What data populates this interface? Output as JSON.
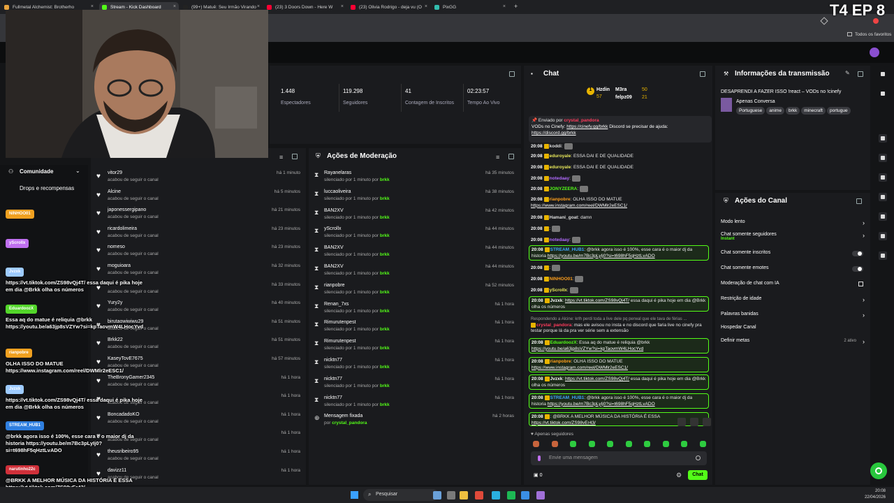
{
  "overlay_title": "T4 EP 8",
  "browser": {
    "tabs": [
      {
        "label": "Fullmetal Alchemist: Brotherho",
        "color": "#e8a33d"
      },
      {
        "label": "Stream - Kick Dashboard",
        "color": "#53fc18"
      },
      {
        "label": "(99+) Matuê: Seu Irmão Virando",
        "color": "#222222"
      },
      {
        "label": "(23) 3 Doors Down - Here W",
        "color": "#ff0033"
      },
      {
        "label": "(23) Olivia Rodrigo - deja vu (O",
        "color": "#ff0033"
      },
      {
        "label": "PixGG",
        "color": "#32bcad"
      }
    ],
    "new_tab": "+",
    "bookmarks_all": "Todos os favoritos"
  },
  "stats": [
    {
      "value": "1.448",
      "label": "Espectadores"
    },
    {
      "value": "119.298",
      "label": "Seguidores"
    },
    {
      "value": "41",
      "label": "Contagem de Inscritos"
    },
    {
      "value": "02:23:57",
      "label": "Tempo Ao Vivo"
    }
  ],
  "followers_panel": {
    "rows": [
      {
        "name": "vitor29",
        "sub": "acabou de seguir o canal",
        "time": "há 1 minuto"
      },
      {
        "name": "Alcine",
        "sub": "acabou de seguir o canal",
        "time": "há 5 minutos"
      },
      {
        "name": "japonessergipano",
        "sub": "acabou de seguir o canal",
        "time": "há 21 minutos"
      },
      {
        "name": "ricardolimeira",
        "sub": "acabou de seguir o canal",
        "time": "há 23 minutos"
      },
      {
        "name": "nomeso",
        "sub": "acabou de seguir o canal",
        "time": "há 23 minutos"
      },
      {
        "name": "moguioara",
        "sub": "acabou de seguir o canal",
        "time": "há 32 minutos"
      },
      {
        "name": "",
        "sub": "acabou de seguir o canal",
        "time": "há 33 minutos"
      },
      {
        "name": "Yury2y",
        "sub": "acabou de seguir o canal",
        "time": "há 40 minutos"
      },
      {
        "name": "birutaowiwiwu29",
        "sub": "acabou de seguir o canal",
        "time": "há 51 minutos"
      },
      {
        "name": "Brkk22",
        "sub": "acabou de seguir o canal",
        "time": "há 51 minutos"
      },
      {
        "name": "KaseyTovE7675",
        "sub": "acabou de seguir o canal",
        "time": "há 57 minutos"
      },
      {
        "name": "TheBronyGamer2345",
        "sub": "acabou de seguir o canal",
        "time": "há 1 hora"
      },
      {
        "name": "",
        "sub": "acabou de seguir o canal",
        "time": "há 1 hora"
      },
      {
        "name": "BoncadadoKO",
        "sub": "acabou de seguir o canal",
        "time": "há 1 hora"
      },
      {
        "name": "",
        "sub": "acabou de seguir o canal",
        "time": "há 1 hora"
      },
      {
        "name": "theusribeiro95",
        "sub": "acabou de seguir o canal",
        "time": "há 1 hora"
      },
      {
        "name": "davizz11",
        "sub": "acabou de seguir o canal",
        "time": "há 1 hora"
      }
    ]
  },
  "moderation_panel": {
    "title": "Ações de Moderação",
    "rows": [
      {
        "name": "Rayanelaras",
        "sub": "silenciado por 1 minuto por",
        "by": "brkk",
        "time": "há 35 minutos"
      },
      {
        "name": "luccaoliveira",
        "sub": "silenciado por 1 minuto por",
        "by": "brkk",
        "time": "há 38 minutos"
      },
      {
        "name": "BAN2XV",
        "sub": "silenciado por 1 minuto por",
        "by": "brkk",
        "time": "há 42 minutos"
      },
      {
        "name": "yScrollx",
        "sub": "silenciado por 1 minuto por",
        "by": "brkk",
        "time": "há 44 minutos"
      },
      {
        "name": "BAN2XV",
        "sub": "silenciado por 1 minuto por",
        "by": "brkk",
        "time": "há 44 minutos"
      },
      {
        "name": "BAN2XV",
        "sub": "silenciado por 1 minuto por",
        "by": "brkk",
        "time": "há 44 minutos"
      },
      {
        "name": "rianpobre",
        "sub": "silenciado por 1 minuto por",
        "by": "brkk",
        "time": "há 52 minutos"
      },
      {
        "name": "Renan_7xs",
        "sub": "silenciado por 1 minuto por",
        "by": "brkk",
        "time": "há 1 hora"
      },
      {
        "name": "Rimurutenpest",
        "sub": "silenciado por 1 minuto por",
        "by": "brkk",
        "time": "há 1 hora"
      },
      {
        "name": "Rimurutenpest",
        "sub": "silenciado por 1 minuto por",
        "by": "brkk",
        "time": "há 1 hora"
      },
      {
        "name": "nicktn77",
        "sub": "silenciado por 1 minuto por",
        "by": "brkk",
        "time": "há 1 hora"
      },
      {
        "name": "nicktn77",
        "sub": "silenciado por 1 minuto por",
        "by": "brkk",
        "time": "há 1 hora"
      },
      {
        "name": "nicktn77",
        "sub": "silenciado por 1 minuto por",
        "by": "brkk",
        "time": "há 1 hora"
      },
      {
        "name": "Mensagem fixada",
        "sub": "por",
        "by": "crystal_pandora",
        "time": "há 2 horas"
      }
    ]
  },
  "chat": {
    "title": "Chat",
    "leaderboard": [
      {
        "rank": "1",
        "name": "Hzdin",
        "pts": "57"
      },
      {
        "rank": "",
        "name": "M3ra",
        "pts": "50"
      },
      {
        "rank": "",
        "name": "felpz09",
        "pts": "21"
      }
    ],
    "pinned": {
      "label": "Enviado por",
      "user": "crystal_pandora",
      "text": "VODs no Cinefy:",
      "link1": "https://cinefy.gg/brkk",
      "text2": "Discord se precisar de ajuda:",
      "link2": "https://discord.gg/brkk"
    },
    "messages": [
      {
        "t": "20:08",
        "u": "koddi",
        "c": "#dddddd",
        "m": "",
        "hl": false
      },
      {
        "t": "20:08",
        "u": "eduroyale",
        "c": "#e8e85a",
        "m": "ESSA DAI E DE QUALIDADE",
        "hl": false
      },
      {
        "t": "20:08",
        "u": "eduroyale",
        "c": "#e8e85a",
        "m": "ESSA DAI E DE QUALIDADE",
        "hl": false
      },
      {
        "t": "20:08",
        "u": "notedaay",
        "c": "#b26bff",
        "m": "",
        "hl": false
      },
      {
        "t": "20:08",
        "u": "JONYZEERA",
        "c": "#53fc18",
        "m": "",
        "hl": false
      },
      {
        "t": "20:08",
        "u": "rianpobre",
        "c": "#ff9f1c",
        "m": "OLHA ISSO DO MATUE",
        "link": "https://www.instagram.com/reel/DWMlr2eESC1/",
        "hl": false
      },
      {
        "t": "20:08",
        "u": "Hamani_goat",
        "c": "#dddddd",
        "m": "damn",
        "hl": false
      },
      {
        "t": "20:08",
        "u": "",
        "c": "#ff3b5c",
        "m": "",
        "hl": false
      },
      {
        "t": "20:08",
        "u": "notedaay",
        "c": "#b26bff",
        "m": "",
        "hl": false
      },
      {
        "t": "20:08",
        "u": "STREAM_HUB1",
        "c": "#3ea6ff",
        "m": "@brkk agora isso é 100%, esse cara é o maior dj da historia",
        "link": "https://youtu.be/m7Bc3pLyIj0?si=t698hF5qHztLvADO",
        "hl": true
      },
      {
        "t": "20:08",
        "u": "",
        "c": "#ff3b5c",
        "m": "",
        "hl": false
      },
      {
        "t": "20:08",
        "u": "NINHOO01",
        "c": "#ff9f1c",
        "m": "",
        "hl": false
      },
      {
        "t": "20:08",
        "u": "yScrollx",
        "c": "#e8e85a",
        "m": "",
        "hl": false
      },
      {
        "t": "20:08",
        "u": "Jvzxk",
        "c": "#ffffff",
        "m": "",
        "link": "https://vt.tiktok.com/ZS98vQj4T/",
        "m2": "essa daqui é pika hoje em dia @Brkk olha os números",
        "hl": true
      },
      {
        "t": "",
        "u": "crystal_pandora",
        "c": "#ff3b5c",
        "reply": "Respondendo a Alcine: krlh perdi toda a live dele pq perwal que ele tava de férias ...",
        "m": "mas ele avisou no insta e no discord que faria live no cinefy pra testar porque lá da pra ver série sem a extensão",
        "hl": false
      },
      {
        "t": "20:08",
        "u": "EduardoozX",
        "c": "#53fc18",
        "m": "Essa aq do matue é reliquia @brkk",
        "link": "https://youtu.be/a63jp8sVZYw?si=kpTaovmW4LHocYvd",
        "hl": true
      },
      {
        "t": "20:08",
        "u": "rianpobre",
        "c": "#ff9f1c",
        "m": "OLHA ISSO DO MATUE",
        "link": "https://www.instagram.com/reel/DWMlr2eESC1/",
        "hl": true
      },
      {
        "t": "20:08",
        "u": "Jvzxk",
        "c": "#ffffff",
        "m": "",
        "link": "https://vt.tiktok.com/ZS98vQj4T/",
        "m2": "essa daqui é pika hoje em dia @Brkk olha os números",
        "hl": true
      },
      {
        "t": "20:08",
        "u": "STREAM_HUB1",
        "c": "#3ea6ff",
        "m": "@brkk agora isso é 100%, esse cara é o maior dj da historia",
        "link": "https://youtu.be/m7Bc3pLyIj0?si=t698hF5qHztLvADO",
        "hl": true
      },
      {
        "t": "20:08",
        "u": "",
        "c": "#ff3b5c",
        "m": "@BRKK A MELHOR MÚSICA DA HISTÓRIA É ESSA",
        "link": "https://vt.tiktok.com/ZS98vEr43/",
        "hl": true
      }
    ],
    "followers_only": "Apenas seguidores",
    "placeholder": "Envie uma mensagem",
    "count": "0",
    "send": "Chat"
  },
  "stream_info": {
    "title": "Informações da transmissão",
    "stream_title": "DESAPRENDI A FAZER ISSO !react – VODs no !cinefy",
    "category": "Apenas Conversa",
    "tags": [
      "Portuguese",
      "anime",
      "brkk",
      "minecraft",
      "portugue"
    ]
  },
  "channel_actions": {
    "title": "Ações do Canal",
    "rows": [
      {
        "label": "Modo lento",
        "sub": "",
        "ctrl": "chev"
      },
      {
        "label": "Chat somente seguidores",
        "sub": "Instant",
        "ctrl": "chev"
      },
      {
        "label": "Chat somente inscritos",
        "sub": "",
        "ctrl": "toggle"
      },
      {
        "label": "Chat somente emotes",
        "sub": "",
        "ctrl": "toggle"
      },
      {
        "label": "Moderação de chat com IA",
        "sub": "",
        "ctrl": "ext"
      },
      {
        "label": "Restrição de idade",
        "sub": "",
        "ctrl": "chev"
      },
      {
        "label": "Palavras banidas",
        "sub": "",
        "ctrl": "chev"
      },
      {
        "label": "Hospedar Canal",
        "sub": "",
        "ctrl": "none"
      },
      {
        "label": "Definir metas",
        "sub": "",
        "ctrl": "chev",
        "note": "2 ativo"
      }
    ]
  },
  "left_sidebar": {
    "community": "Comunidade",
    "drops": "Drops e recompensas"
  },
  "chat_overlay": [
    {
      "name": "Jvzxk",
      "color": "#9ecbff",
      "text": "https://vt.tiktok.com/ZS98vQj4T/ essa daqui é pika hoje em dia @Brkk olha os números"
    },
    {
      "name": "EduardoozX",
      "color": "#53d62a",
      "text": "Essa aq do matue é reliquia @brkk https://youtu.be/a63jp8sVZYw?si=kpTaovmW4LHocYvd"
    },
    {
      "name": "rianpobre",
      "color": "#f0a020",
      "text": "OLHA ISSO DO MATUE https://www.instagram.com/reel/DWMlr2eESC1/"
    },
    {
      "name": "Jvzxk",
      "color": "#9ecbff",
      "text": "https://vt.tiktok.com/ZS98vQj4T/ essa daqui é pika hoje em dia @Brkk olha os números"
    },
    {
      "name": "STREAM_HUB1",
      "color": "#2f7fe0",
      "text": "@brkk agora isso é 100%, esse cara é o maior dj da historia https://youtu.be/m7Bc3pLyIj0?si=t698hF5qHztLvADO"
    },
    {
      "name": "narutinho22c",
      "color": "#d0303a",
      "text": "@BRKK A MELHOR MÚSICA DA HISTÓRIA É ESSA https://vt.tiktok.com/ZS98vEr43/"
    }
  ],
  "overlay_small": [
    {
      "name": "NINHOO01",
      "color": "#f0a020"
    },
    {
      "name": "yScrollx",
      "color": "#c070f0"
    }
  ],
  "taskbar": {
    "search": "Pesquisar",
    "time": "20:08",
    "date": "22/04/2026"
  }
}
